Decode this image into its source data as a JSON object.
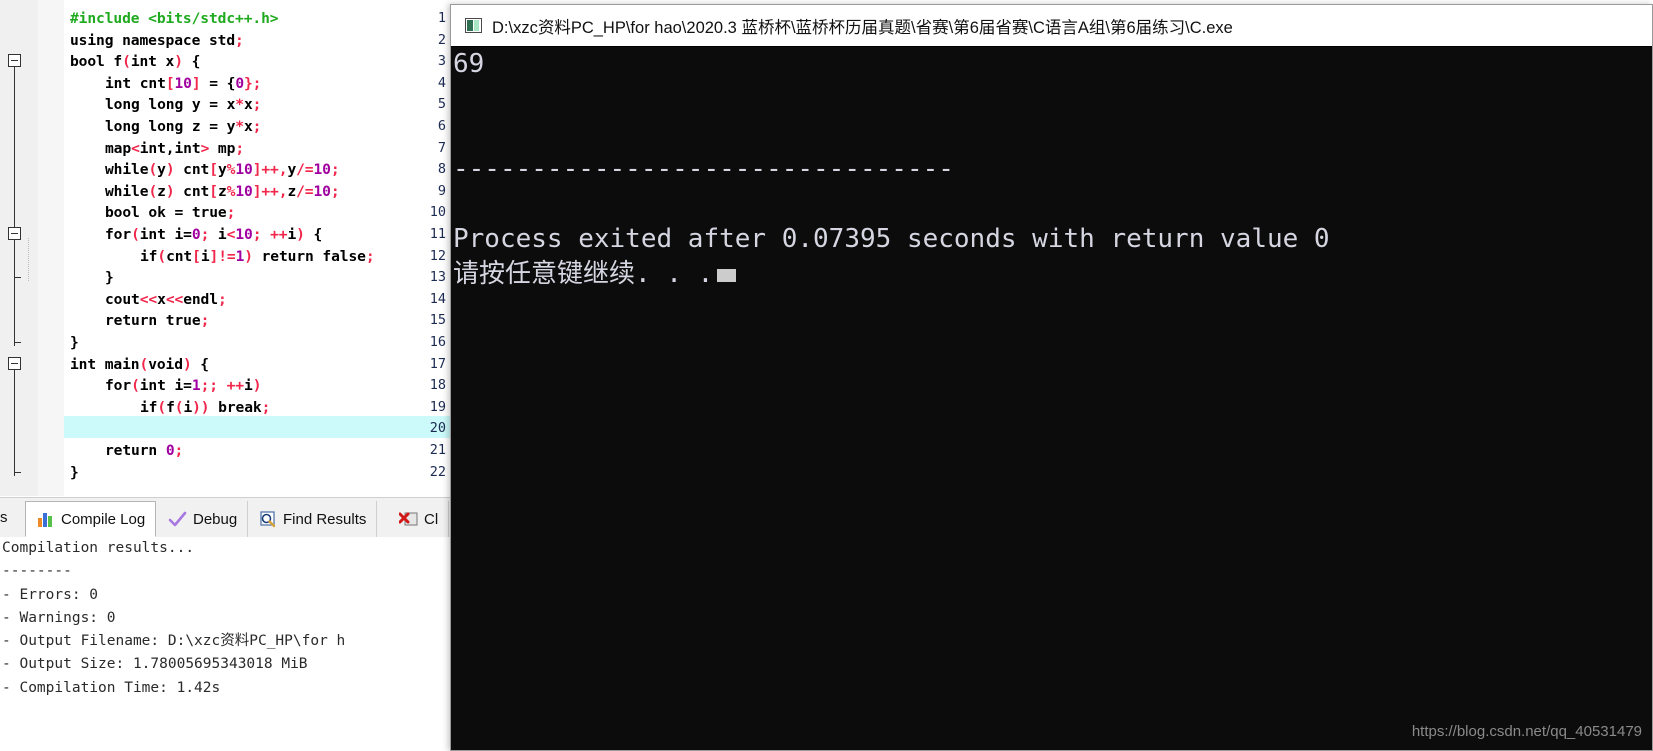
{
  "ide": {
    "editor": {
      "lines": [
        {
          "n": "1",
          "tokens": [
            {
              "t": "#include <bits/stdc++.h>",
              "c": "t-pre"
            }
          ],
          "indent": 0
        },
        {
          "n": "2",
          "tokens": [
            {
              "t": "using namespace std",
              "c": "t-kw"
            },
            {
              "t": ";",
              "c": "t-pun"
            }
          ],
          "indent": 0
        },
        {
          "n": "3",
          "tokens": [
            {
              "t": "bool f",
              "c": "t-kw"
            },
            {
              "t": "(",
              "c": "t-pun"
            },
            {
              "t": "int x",
              "c": "t-kw"
            },
            {
              "t": ")",
              "c": "t-pun"
            },
            {
              "t": " {",
              "c": "t-kw"
            }
          ],
          "indent": 0
        },
        {
          "n": "4",
          "tokens": [
            {
              "t": "int cnt",
              "c": "t-kw"
            },
            {
              "t": "[",
              "c": "t-pun"
            },
            {
              "t": "10",
              "c": "t-num"
            },
            {
              "t": "]",
              "c": "t-pun"
            },
            {
              "t": " = {",
              "c": "t-kw"
            },
            {
              "t": "0",
              "c": "t-num"
            },
            {
              "t": "};",
              "c": "t-pun"
            }
          ],
          "indent": 1
        },
        {
          "n": "5",
          "tokens": [
            {
              "t": "long long y = x",
              "c": "t-kw"
            },
            {
              "t": "*",
              "c": "t-pun"
            },
            {
              "t": "x",
              "c": "t-kw"
            },
            {
              "t": ";",
              "c": "t-pun"
            }
          ],
          "indent": 1
        },
        {
          "n": "6",
          "tokens": [
            {
              "t": "long long z = y",
              "c": "t-kw"
            },
            {
              "t": "*",
              "c": "t-pun"
            },
            {
              "t": "x",
              "c": "t-kw"
            },
            {
              "t": ";",
              "c": "t-pun"
            }
          ],
          "indent": 1
        },
        {
          "n": "7",
          "tokens": [
            {
              "t": "map",
              "c": "t-kw"
            },
            {
              "t": "<",
              "c": "t-pun"
            },
            {
              "t": "int,int",
              "c": "t-kw"
            },
            {
              "t": ">",
              "c": "t-pun"
            },
            {
              "t": " mp",
              "c": "t-kw"
            },
            {
              "t": ";",
              "c": "t-pun"
            }
          ],
          "indent": 1
        },
        {
          "n": "8",
          "tokens": [
            {
              "t": "while",
              "c": "t-kw"
            },
            {
              "t": "(",
              "c": "t-pun"
            },
            {
              "t": "y",
              "c": "t-kw"
            },
            {
              "t": ")",
              "c": "t-pun"
            },
            {
              "t": " cnt",
              "c": "t-kw"
            },
            {
              "t": "[",
              "c": "t-pun"
            },
            {
              "t": "y",
              "c": "t-kw"
            },
            {
              "t": "%",
              "c": "t-pun"
            },
            {
              "t": "10",
              "c": "t-num"
            },
            {
              "t": "]",
              "c": "t-pun"
            },
            {
              "t": "++,",
              "c": "t-pun"
            },
            {
              "t": "y",
              "c": "t-kw"
            },
            {
              "t": "/=",
              "c": "t-pun"
            },
            {
              "t": "10",
              "c": "t-num"
            },
            {
              "t": ";",
              "c": "t-pun"
            }
          ],
          "indent": 1
        },
        {
          "n": "9",
          "tokens": [
            {
              "t": "while",
              "c": "t-kw"
            },
            {
              "t": "(",
              "c": "t-pun"
            },
            {
              "t": "z",
              "c": "t-kw"
            },
            {
              "t": ")",
              "c": "t-pun"
            },
            {
              "t": " cnt",
              "c": "t-kw"
            },
            {
              "t": "[",
              "c": "t-pun"
            },
            {
              "t": "z",
              "c": "t-kw"
            },
            {
              "t": "%",
              "c": "t-pun"
            },
            {
              "t": "10",
              "c": "t-num"
            },
            {
              "t": "]",
              "c": "t-pun"
            },
            {
              "t": "++,",
              "c": "t-pun"
            },
            {
              "t": "z",
              "c": "t-kw"
            },
            {
              "t": "/=",
              "c": "t-pun"
            },
            {
              "t": "10",
              "c": "t-num"
            },
            {
              "t": ";",
              "c": "t-pun"
            }
          ],
          "indent": 1
        },
        {
          "n": "10",
          "tokens": [
            {
              "t": "bool ok = true",
              "c": "t-kw"
            },
            {
              "t": ";",
              "c": "t-pun"
            }
          ],
          "indent": 1
        },
        {
          "n": "11",
          "tokens": [
            {
              "t": "for",
              "c": "t-kw"
            },
            {
              "t": "(",
              "c": "t-pun"
            },
            {
              "t": "int i=",
              "c": "t-kw"
            },
            {
              "t": "0",
              "c": "t-num"
            },
            {
              "t": ";",
              "c": "t-pun"
            },
            {
              "t": " i",
              "c": "t-kw"
            },
            {
              "t": "<",
              "c": "t-pun"
            },
            {
              "t": "10",
              "c": "t-num"
            },
            {
              "t": ";",
              "c": "t-pun"
            },
            {
              "t": " ",
              "c": "t-kw"
            },
            {
              "t": "++",
              "c": "t-pun"
            },
            {
              "t": "i",
              "c": "t-kw"
            },
            {
              "t": ")",
              "c": "t-pun"
            },
            {
              "t": " {",
              "c": "t-kw"
            }
          ],
          "indent": 1
        },
        {
          "n": "12",
          "tokens": [
            {
              "t": "if",
              "c": "t-kw"
            },
            {
              "t": "(",
              "c": "t-pun"
            },
            {
              "t": "cnt",
              "c": "t-kw"
            },
            {
              "t": "[",
              "c": "t-pun"
            },
            {
              "t": "i",
              "c": "t-kw"
            },
            {
              "t": "]",
              "c": "t-pun"
            },
            {
              "t": "!=",
              "c": "t-pun"
            },
            {
              "t": "1",
              "c": "t-num"
            },
            {
              "t": ")",
              "c": "t-pun"
            },
            {
              "t": " return false",
              "c": "t-kw"
            },
            {
              "t": ";",
              "c": "t-pun"
            }
          ],
          "indent": 2
        },
        {
          "n": "13",
          "tokens": [
            {
              "t": "}",
              "c": "t-kw"
            }
          ],
          "indent": 1
        },
        {
          "n": "14",
          "tokens": [
            {
              "t": "cout",
              "c": "t-kw"
            },
            {
              "t": "<<",
              "c": "t-pun"
            },
            {
              "t": "x",
              "c": "t-kw"
            },
            {
              "t": "<<",
              "c": "t-pun"
            },
            {
              "t": "endl",
              "c": "t-kw"
            },
            {
              "t": ";",
              "c": "t-pun"
            }
          ],
          "indent": 1
        },
        {
          "n": "15",
          "tokens": [
            {
              "t": "return true",
              "c": "t-kw"
            },
            {
              "t": ";",
              "c": "t-pun"
            }
          ],
          "indent": 1
        },
        {
          "n": "16",
          "tokens": [
            {
              "t": "}",
              "c": "t-kw"
            }
          ],
          "indent": 0
        },
        {
          "n": "17",
          "tokens": [
            {
              "t": "int main",
              "c": "t-kw"
            },
            {
              "t": "(",
              "c": "t-pun"
            },
            {
              "t": "void",
              "c": "t-kw"
            },
            {
              "t": ")",
              "c": "t-pun"
            },
            {
              "t": " {",
              "c": "t-kw"
            }
          ],
          "indent": 0
        },
        {
          "n": "18",
          "tokens": [
            {
              "t": "for",
              "c": "t-kw"
            },
            {
              "t": "(",
              "c": "t-pun"
            },
            {
              "t": "int i=",
              "c": "t-kw"
            },
            {
              "t": "1",
              "c": "t-num"
            },
            {
              "t": ";;",
              "c": "t-pun"
            },
            {
              "t": " ",
              "c": "t-kw"
            },
            {
              "t": "++",
              "c": "t-pun"
            },
            {
              "t": "i",
              "c": "t-kw"
            },
            {
              "t": ")",
              "c": "t-pun"
            }
          ],
          "indent": 1
        },
        {
          "n": "19",
          "tokens": [
            {
              "t": "if",
              "c": "t-kw"
            },
            {
              "t": "(",
              "c": "t-pun"
            },
            {
              "t": "f",
              "c": "t-kw"
            },
            {
              "t": "(",
              "c": "t-pun"
            },
            {
              "t": "i",
              "c": "t-kw"
            },
            {
              "t": "))",
              "c": "t-pun"
            },
            {
              "t": " break",
              "c": "t-kw"
            },
            {
              "t": ";",
              "c": "t-pun"
            }
          ],
          "indent": 2
        },
        {
          "n": "20",
          "tokens": [],
          "indent": 0
        },
        {
          "n": "21",
          "tokens": [
            {
              "t": "return ",
              "c": "t-kw"
            },
            {
              "t": "0",
              "c": "t-num"
            },
            {
              "t": ";",
              "c": "t-pun"
            }
          ],
          "indent": 1
        },
        {
          "n": "22",
          "tokens": [
            {
              "t": "}",
              "c": "t-kw"
            }
          ],
          "indent": 0
        }
      ],
      "current_line": "20"
    },
    "tabs": [
      {
        "label": "Compile Log",
        "icon": "bar-chart-icon",
        "active": true
      },
      {
        "label": "Debug",
        "icon": "check-mark-icon",
        "active": false
      },
      {
        "label": "Find Results",
        "icon": "magnifier-icon",
        "active": false
      },
      {
        "label": "Cl",
        "icon": "close-bug-icon",
        "active": false
      }
    ],
    "tab_clip_glyph": "s",
    "compile_log": [
      "Compilation results...",
      "--------",
      "- Errors: 0",
      "- Warnings: 0",
      "- Output Filename: D:\\xzc资料PC_HP\\for h",
      "- Output Size: 1.78005695343018 MiB",
      "- Compilation Time: 1.42s"
    ]
  },
  "console": {
    "title": "D:\\xzc资料PC_HP\\for hao\\2020.3 蓝桥杯\\蓝桥杯历届真题\\省赛\\第6届省赛\\C语言A组\\第6届练习\\C.exe",
    "icon": "console-window-icon",
    "lines": [
      "69",
      "",
      "",
      "--------------------------------",
      "",
      "Process exited after 0.07395 seconds with return value 0"
    ],
    "prompt_text": "请按任意键继续. . .",
    "cursor": "block-cursor"
  },
  "watermark": "https://blog.csdn.net/qq_40531479",
  "colors": {
    "gutter_bg": "#f0f0f0",
    "line_number": "#1c2b52",
    "current_line_highlight": "#ccfafa",
    "preprocessor": "#1faa1f",
    "punctuation": "#f0264b",
    "number": "#a000a0",
    "console_bg": "#0c0c0c",
    "console_text": "#d6d6e2"
  }
}
